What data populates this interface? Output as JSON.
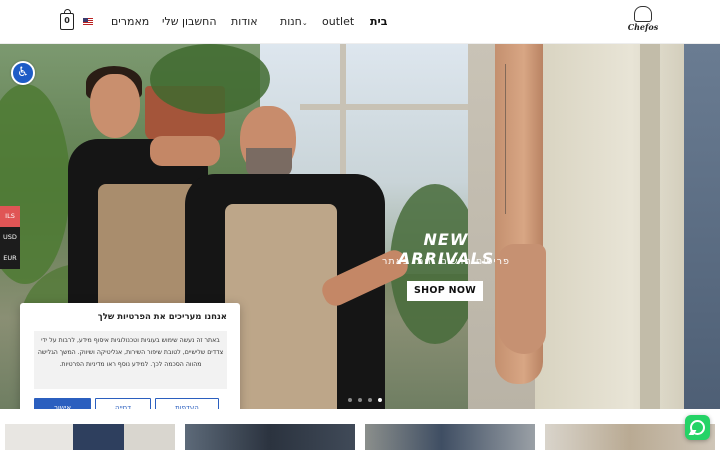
{
  "header": {
    "logo_text": "Chefos",
    "nav": {
      "home": "בית",
      "outlet": "outlet",
      "shops": "חנות",
      "about": "אודות",
      "account": "החשבון שלי",
      "articles": "מאמרים"
    },
    "cart_count": "0",
    "language_flag": "us-flag-icon"
  },
  "hero": {
    "title": "NEW ARRIVALS",
    "subtitle": "פריטים חדשים נחתו באתר",
    "cta_label": "SHOP NOW"
  },
  "currency": [
    "ILS",
    "USD",
    "EUR"
  ],
  "cookie": {
    "title": "אנחנו מעריכים את הפרטיות שלך",
    "body": "באתר זה נעשה שימוש בעוגיות וטכנולוגיות איסוף מידע, לרבות על ידי צדדים שלישיים, לטובת שיפור השירות, אנליטיקה ושיווק. המשך הגלישה מהווה הסכמה לכך. למידע נוסף ראו מדיניות הפרטיות.",
    "btn_preferences": "העדפות",
    "btn_reject": "דחייה",
    "btn_accept": "אישור"
  },
  "colors": {
    "accent": "#2b5fbf",
    "currency_active": "#e05555",
    "whatsapp": "#25d366"
  }
}
